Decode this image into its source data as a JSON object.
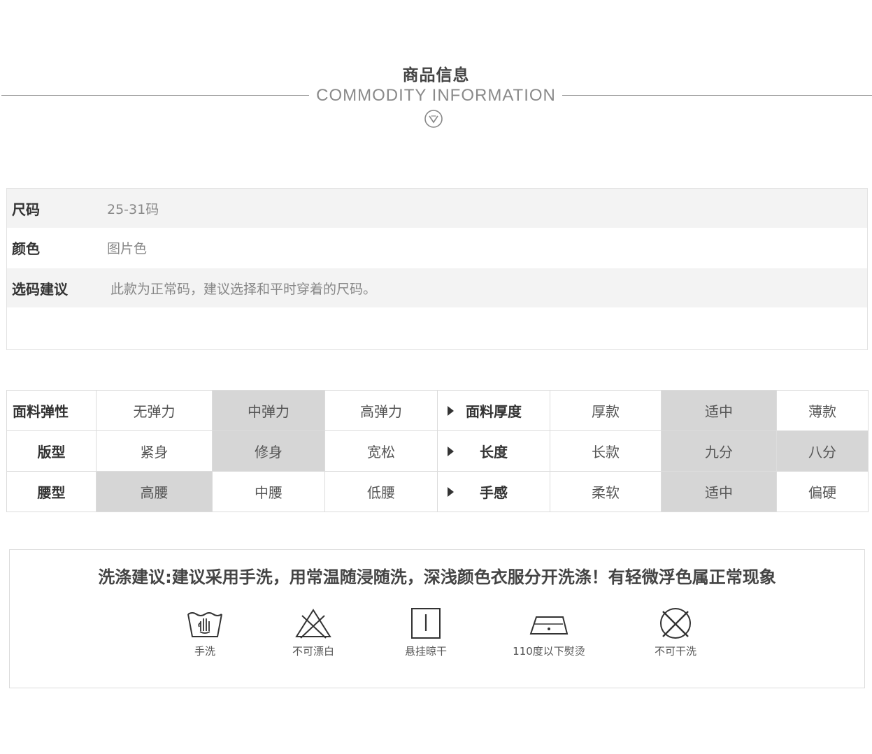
{
  "header": {
    "title": "商品信息",
    "subtitle": "COMMODITY INFORMATION",
    "icon": "chevron-down-circle-icon"
  },
  "info": [
    {
      "key": "尺码",
      "value": "25-31码"
    },
    {
      "key": "颜色",
      "value": "图片色"
    },
    {
      "key": "选码建议",
      "value": "此款为正常码，建议选择和平时穿着的尺码。"
    }
  ],
  "attributes": {
    "rows": [
      {
        "label": "面料弹性",
        "options": [
          "无弹力",
          "中弹力",
          "高弹力"
        ],
        "selected": 1,
        "label2": "面料厚度",
        "options2": [
          "厚款",
          "适中",
          "薄款"
        ],
        "selected2": 1
      },
      {
        "label": "版型",
        "options": [
          "紧身",
          "修身",
          "宽松"
        ],
        "selected": 1,
        "label2": "长度",
        "options2": [
          "长款",
          "九分",
          "八分"
        ],
        "selected2": [
          1,
          2
        ]
      },
      {
        "label": "腰型",
        "options": [
          "高腰",
          "中腰",
          "低腰"
        ],
        "selected": 0,
        "label2": "手感",
        "options2": [
          "柔软",
          "适中",
          "偏硬"
        ],
        "selected2": 1
      }
    ],
    "highlight_color": "#d6d6d6"
  },
  "washing": {
    "text": "洗涤建议:建议采用手洗，用常温随浸随洗，深浅颜色衣服分开洗涤！有轻微浮色属正常现象",
    "icons": [
      {
        "icon": "hand-wash-icon",
        "label": "手洗"
      },
      {
        "icon": "no-bleach-icon",
        "label": "不可漂白"
      },
      {
        "icon": "hang-dry-icon",
        "label": "悬挂晾干"
      },
      {
        "icon": "iron-icon",
        "label": "110度以下熨烫"
      },
      {
        "icon": "no-dry-clean-icon",
        "label": "不可干洗"
      }
    ]
  }
}
